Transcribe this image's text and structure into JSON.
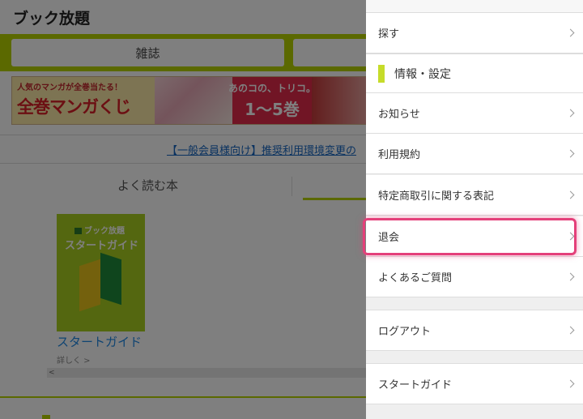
{
  "app": {
    "title": "ブック放題"
  },
  "categories": [
    "雑誌",
    ""
  ],
  "banner": {
    "headline": "人気のマンガが全巻当たる！",
    "big": "全巻マンガくじ",
    "promo_top": "あのコの、トリコ。",
    "promo_bottom": "1〜5巻"
  },
  "notice": {
    "text": "【一般会員様向け】推奨利用環境変更の"
  },
  "sub_tabs": {
    "first": "よく読む本"
  },
  "book": {
    "brand": "ブック放題",
    "cover_title": "スタートガイド",
    "title": "スタートガイド",
    "detail": "詳しく >"
  },
  "drawer": {
    "search": "探す",
    "section_title": "情報・設定",
    "items": [
      {
        "label": "お知らせ"
      },
      {
        "label": "利用規約"
      },
      {
        "label": "特定商取引に関する表記"
      },
      {
        "label": "退会"
      },
      {
        "label": "よくあるご質問"
      }
    ],
    "logout": "ログアウト",
    "start_guide": "スタートガイド"
  },
  "colors": {
    "brand_green": "#b6d300",
    "highlight": "#e4407a",
    "link_blue": "#1565c0"
  }
}
